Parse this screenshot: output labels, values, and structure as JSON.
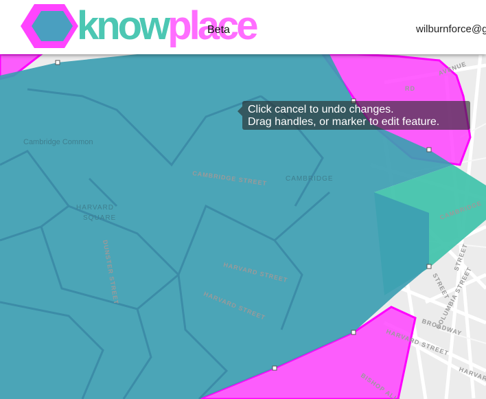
{
  "header": {
    "logo_part1": "know",
    "logo_part2": "place",
    "beta_label": "Beta",
    "user_email": "wilburnforce@g",
    "colors": {
      "teal": "#4cc7b3",
      "magenta": "#ff6dff",
      "hexagon_blue": "#4a9fc0"
    }
  },
  "tooltip": {
    "line1": "Click cancel to undo changes.",
    "line2": "Drag handles, or marker to edit feature."
  },
  "map": {
    "labels": {
      "cambridge_common": "Cambridge Common",
      "harvard": "HARVARD",
      "square": "SQUARE",
      "cambridge": "CAMBRIDGE",
      "cambridge_street": "CAMBRIDGE STREET",
      "cambridge_street_2": "CAMBRIDGE",
      "harvard_street": "HARVARD STREET",
      "harvard_street_2": "HARVARD STREET",
      "harvard_street_3": "HARVARD",
      "broadway": "BROADWAY",
      "columbia_street": "COLUMBIA STREET",
      "street_e": "STREET",
      "bishop_allen": "BISHOP ALLEN",
      "avenue": "AVENUE",
      "dunster_street": "DUNSTER STREET",
      "street_d": "STREET",
      "rd": "RD"
    },
    "colors": {
      "base": "#ececec",
      "road": "#ffffff",
      "polygon_blue": "#3d9eb2",
      "polygon_teal": "#45c4ad",
      "polygon_magenta": "#ff44ff"
    }
  }
}
